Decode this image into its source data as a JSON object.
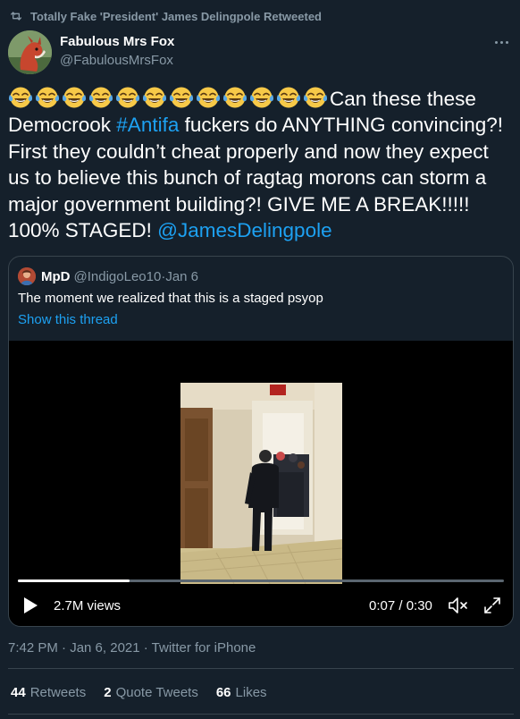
{
  "retweet_header": {
    "text": "Totally Fake 'President' James Delingpole Retweeted"
  },
  "author": {
    "display_name": "Fabulous Mrs Fox",
    "handle": "@FabulousMrsFox"
  },
  "tweet": {
    "emoji": "face-with-tears-of-joy",
    "emoji_count": 12,
    "text_1": "Can these these Democrook ",
    "hashtag": "#Antifa",
    "text_2": " fuckers do ANYTHING convincing?! First they couldn’t cheat properly and now they expect us to believe this bunch of ragtag morons can storm a major government building?! GIVE ME A BREAK!!!!! 100% STAGED!  ",
    "mention": "@JamesDelingpole"
  },
  "quote": {
    "name": "MpD",
    "handle": "@IndigoLeo10",
    "separator": " · ",
    "date": "Jan 6",
    "text": "The moment we realized that this is a staged psyop",
    "show_thread": "Show this thread"
  },
  "video": {
    "views": "2.7M views",
    "time": "0:07 / 0:30",
    "progress": 0.23
  },
  "meta": {
    "timestamp": "7:42 PM · Jan 6, 2021 · Twitter for iPhone"
  },
  "stats": {
    "retweets_count": "44",
    "retweets_label": "Retweets",
    "quotes_count": "2",
    "quotes_label": "Quote Tweets",
    "likes_count": "66",
    "likes_label": "Likes"
  },
  "colors": {
    "background": "#15202b",
    "link": "#1da1f2",
    "secondary_text": "#8899a6",
    "border": "#38444d"
  }
}
